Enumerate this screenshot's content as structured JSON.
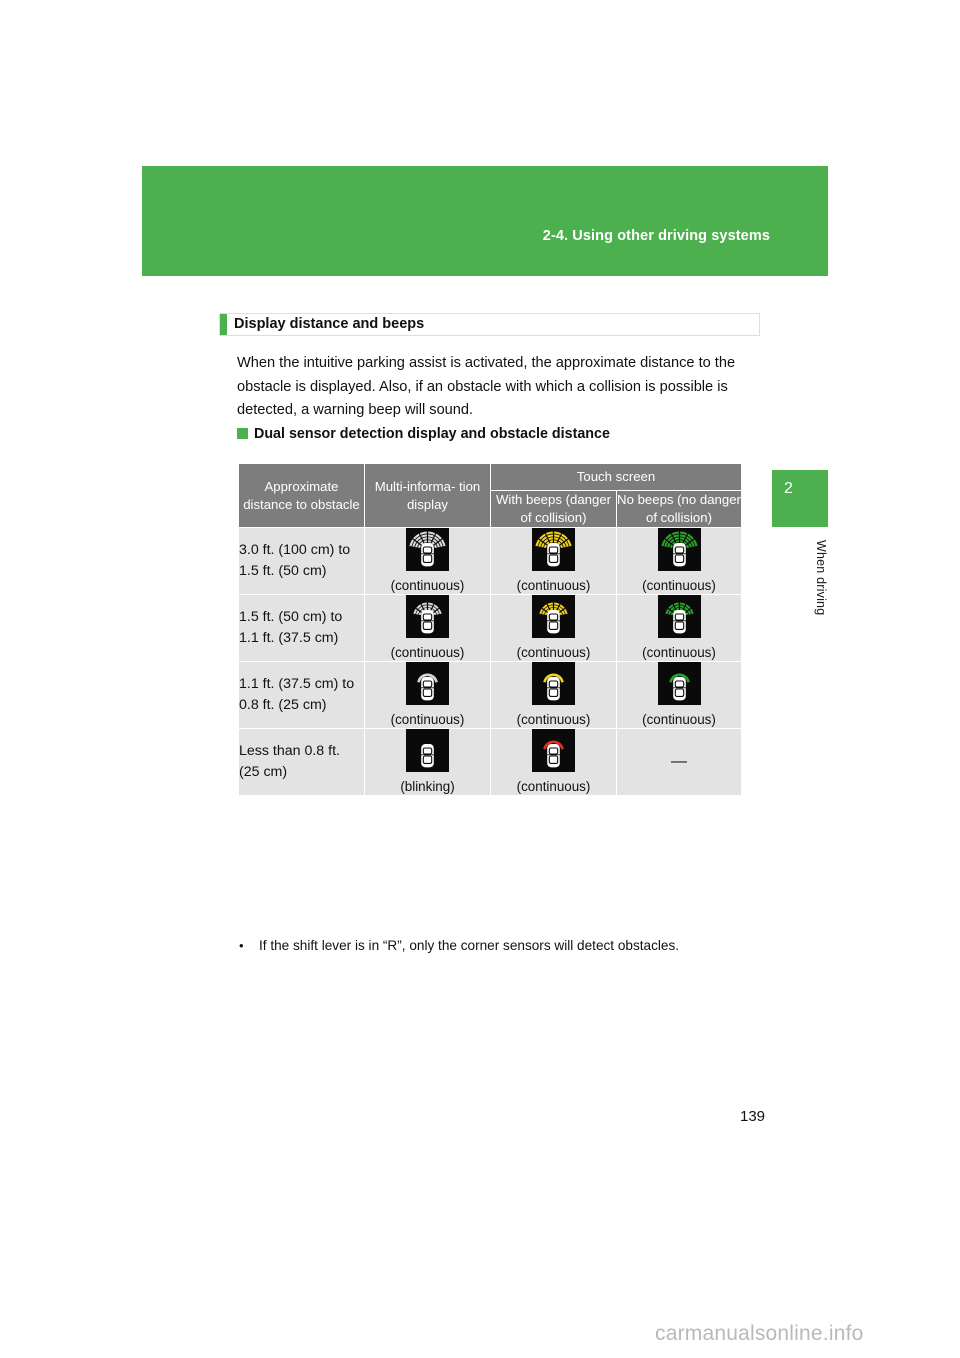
{
  "banner": {
    "title": "2-4. Using other driving systems",
    "color": "#4CB04E"
  },
  "side_tab": {
    "chapter_number": "2",
    "chapter_label": "When driving",
    "color": "#4CB04E"
  },
  "section": {
    "heading": "Display distance and beeps",
    "paragraph": "When the intuitive parking assist is activated, the approximate distance to the obstacle is displayed. Also, if an obstacle with which a collision is possible is detected, a warning beep will sound.",
    "subheading": "Dual sensor detection display and obstacle distance"
  },
  "table": {
    "headers": {
      "col1": "Approximate distance to obstacle",
      "col2": "Multi-informa- tion display",
      "group": "Touch screen",
      "col3": "With beeps (danger of collision)",
      "col4": "No beeps (no danger of collision)"
    },
    "header_bg": "#7d7d7d",
    "row_bg": "#e3e3e3",
    "rows": [
      {
        "distance": "3.0 ft. (100 cm) to 1.5 ft. (50 cm)",
        "mid": {
          "icon": "parking-sensor-car-arcs-white-icon",
          "caption": "(continuous)",
          "arc_color": "#d9d9d9",
          "arc_level": 3
        },
        "beeps": {
          "icon": "parking-sensor-car-arcs-yellow-icon",
          "caption": "(continuous)",
          "arc_color": "#f2d21a",
          "arc_level": 3
        },
        "nobeeps": {
          "icon": "parking-sensor-car-arcs-green-icon",
          "caption": "(continuous)",
          "arc_color": "#2aa12a",
          "arc_level": 3
        }
      },
      {
        "distance": "1.5 ft. (50 cm) to 1.1 ft. (37.5 cm)",
        "mid": {
          "icon": "parking-sensor-car-arcs-white-icon",
          "caption": "(continuous)",
          "arc_color": "#d9d9d9",
          "arc_level": 2
        },
        "beeps": {
          "icon": "parking-sensor-car-arcs-yellow-icon",
          "caption": "(continuous)",
          "arc_color": "#f2d21a",
          "arc_level": 2
        },
        "nobeeps": {
          "icon": "parking-sensor-car-arcs-green-icon",
          "caption": "(continuous)",
          "arc_color": "#2aa12a",
          "arc_level": 2
        }
      },
      {
        "distance": "1.1 ft. (37.5 cm) to 0.8 ft. (25 cm)",
        "mid": {
          "icon": "parking-sensor-car-arcs-white-icon",
          "caption": "(continuous)",
          "arc_color": "#d9d9d9",
          "arc_level": 1
        },
        "beeps": {
          "icon": "parking-sensor-car-arcs-yellow-icon",
          "caption": "(continuous)",
          "arc_color": "#f2d21a",
          "arc_level": 1
        },
        "nobeeps": {
          "icon": "parking-sensor-car-arcs-green-icon",
          "caption": "(continuous)",
          "arc_color": "#2aa12a",
          "arc_level": 1
        }
      },
      {
        "distance": "Less than 0.8 ft. (25 cm)",
        "mid": {
          "icon": "parking-sensor-car-no-arc-icon",
          "caption": "(blinking)",
          "arc_color": "#ffffff",
          "arc_level": 0
        },
        "beeps": {
          "icon": "parking-sensor-car-arc-red-icon",
          "caption": "(continuous)",
          "arc_color": "#e8301f",
          "arc_level": 1
        },
        "nobeeps": {
          "icon": "none",
          "caption": "—",
          "arc_color": "",
          "arc_level": -1
        }
      }
    ]
  },
  "note": {
    "bullet": "•",
    "text": "If the shift lever is in “R”, only the corner sensors will detect obstacles."
  },
  "page_number": "139",
  "watermark": "carmanualsonline.info"
}
